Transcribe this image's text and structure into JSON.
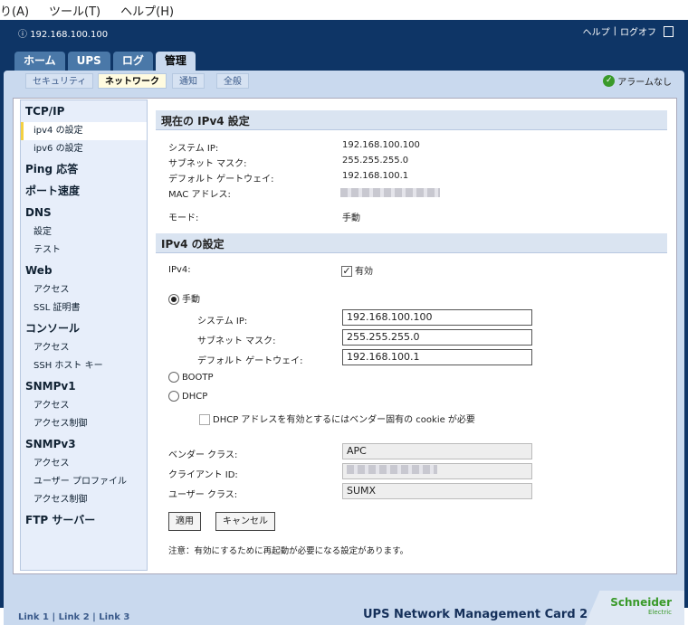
{
  "menubar": {
    "items": [
      "り(A)",
      "ツール(T)",
      "ヘルプ(H)"
    ]
  },
  "header": {
    "ip": "192.168.100.100",
    "help": "ヘルプ",
    "sep": "|",
    "logoff": "ログオフ"
  },
  "tabs": [
    "ホーム",
    "UPS",
    "ログ",
    "管理"
  ],
  "subnav": [
    "セキュリティ",
    "ネットワーク",
    "通知",
    "全般"
  ],
  "alarm": "アラームなし",
  "sidebar": [
    {
      "h": "TCP/IP",
      "items": [
        "ipv4 の設定",
        "ipv6 の設定"
      ]
    },
    {
      "h": "Ping 応答",
      "items": []
    },
    {
      "h": "ポート速度",
      "items": []
    },
    {
      "h": "DNS",
      "items": [
        "設定",
        "テスト"
      ]
    },
    {
      "h": "Web",
      "items": [
        "アクセス",
        "SSL 証明書"
      ]
    },
    {
      "h": "コンソール",
      "items": [
        "アクセス",
        "SSH ホスト キー"
      ]
    },
    {
      "h": "SNMPv1",
      "items": [
        "アクセス",
        "アクセス制御"
      ]
    },
    {
      "h": "SNMPv3",
      "items": [
        "アクセス",
        "ユーザー プロファイル",
        "アクセス制御"
      ]
    },
    {
      "h": "FTP サーバー",
      "items": []
    }
  ],
  "current": {
    "title": "現在の IPv4 設定",
    "rows": [
      [
        "システム IP:",
        "192.168.100.100"
      ],
      [
        "サブネット マスク:",
        "255.255.255.0"
      ],
      [
        "デフォルト ゲートウェイ:",
        "192.168.100.1"
      ],
      [
        "MAC アドレス:",
        ""
      ],
      [
        "モード:",
        "手動"
      ]
    ]
  },
  "settings": {
    "title": "IPv4 の設定",
    "ipv4_label": "IPv4:",
    "ipv4_value": "有効",
    "manual": "手動",
    "sys_ip_label": "システム IP:",
    "sys_ip": "192.168.100.100",
    "mask_label": "サブネット マスク:",
    "mask": "255.255.255.0",
    "gw_label": "デフォルト ゲートウェイ:",
    "gw": "192.168.100.1",
    "bootp": "BOOTP",
    "dhcp": "DHCP",
    "dhcp_cookie": "DHCP アドレスを有効とするにはベンダー固有の cookie が必要",
    "vendor_label": "ベンダー クラス:",
    "vendor": "APC",
    "client_label": "クライアント ID:",
    "user_label": "ユーザー クラス:",
    "user": "SUMX",
    "apply": "適用",
    "cancel": "キャンセル",
    "note": "注意：有効にするために再起動が必要になる設定があります。"
  },
  "footer": {
    "links": [
      "Link 1",
      "Link 2",
      "Link 3"
    ],
    "product": "UPS Network Management Card 2",
    "logo": "Schneider",
    "logo_sub": "Electric"
  }
}
